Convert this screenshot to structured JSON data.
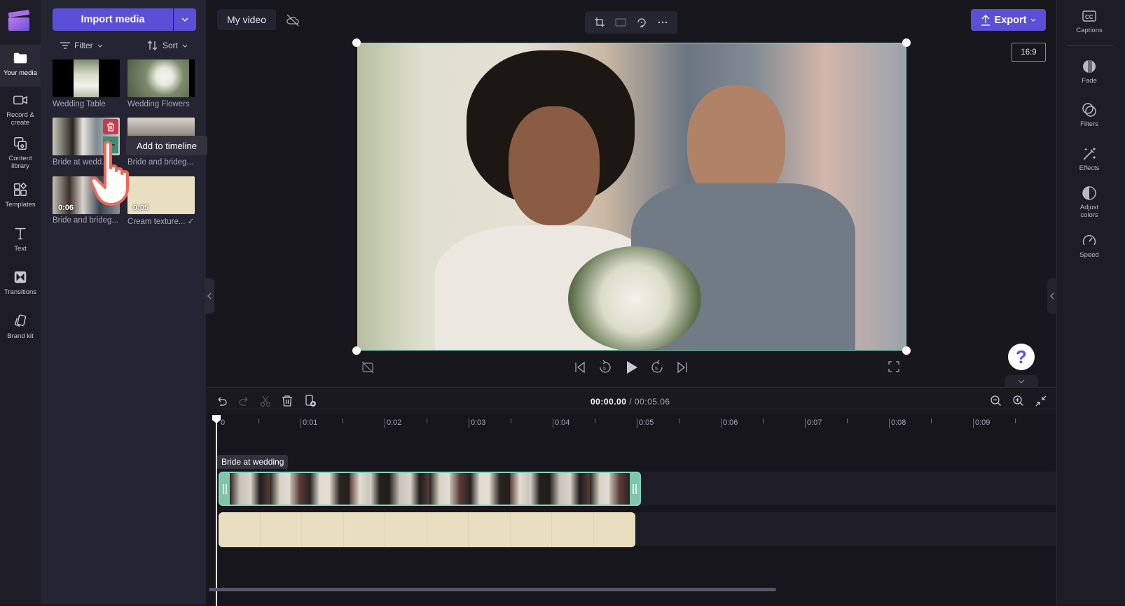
{
  "left_nav": {
    "items": [
      {
        "label": "Your media",
        "icon": "folder-icon",
        "active": true
      },
      {
        "label": "Record & create",
        "icon": "video-camera-icon"
      },
      {
        "label": "Content library",
        "icon": "content-library-icon"
      },
      {
        "label": "Templates",
        "icon": "templates-icon"
      },
      {
        "label": "Text",
        "icon": "text-icon"
      },
      {
        "label": "Transitions",
        "icon": "transitions-icon"
      },
      {
        "label": "Brand kit",
        "icon": "brand-kit-icon"
      }
    ]
  },
  "media_panel": {
    "import_label": "Import media",
    "filter_label": "Filter",
    "sort_label": "Sort",
    "items": [
      {
        "label": "Wedding Table",
        "duration": ""
      },
      {
        "label": "Wedding Flowers",
        "duration": ""
      },
      {
        "label": "Bride at wedd...",
        "duration": ""
      },
      {
        "label": "Bride and brideg...",
        "duration": ""
      },
      {
        "label": "Bride and brideg...",
        "duration": "0:06"
      },
      {
        "label": "Cream texture...",
        "duration": "0:05"
      }
    ],
    "tooltip": "Add to timeline"
  },
  "topbar": {
    "project_title": "My video",
    "export_label": "Export",
    "aspect_ratio": "16:9"
  },
  "right_panel": {
    "items": [
      {
        "label": "Captions",
        "icon": "captions-icon"
      },
      {
        "label": "Fade",
        "icon": "fade-icon"
      },
      {
        "label": "Filters",
        "icon": "filters-icon"
      },
      {
        "label": "Effects",
        "icon": "effects-icon"
      },
      {
        "label": "Adjust colors",
        "icon": "adjust-colors-icon"
      },
      {
        "label": "Speed",
        "icon": "speed-icon"
      }
    ]
  },
  "timeline": {
    "current_time": "00:00.00",
    "total_time": "/ 00:05.06",
    "ruler_labels": [
      "0",
      "0:01",
      "0:02",
      "0:03",
      "0:04",
      "0:05",
      "0:06",
      "0:07",
      "0:08",
      "0:09"
    ],
    "clip_label": "Bride at wedding"
  },
  "colors": {
    "accent": "#5b4fd8",
    "selection": "#7fd6bd",
    "delete": "#c83a4e",
    "add": "#3e8c73",
    "cream": "#e9dfc0"
  }
}
